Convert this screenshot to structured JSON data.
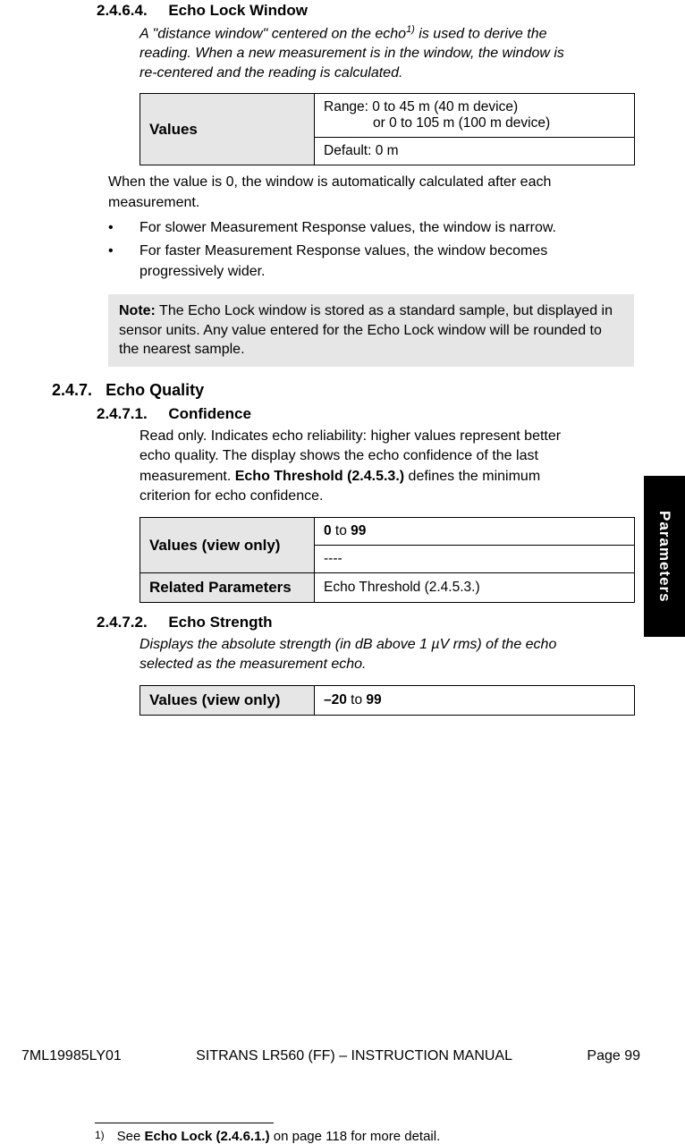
{
  "sideTab": "Parameters",
  "s2464": {
    "num": "2.4.6.4.",
    "title": "Echo Lock Window",
    "intro_a": "A \"distance window\" centered on the echo",
    "intro_sup": "1)",
    "intro_b": " is used to derive the reading. When a new measurement is in the window, the window is re-centered and the reading is calculated.",
    "valuesLabel": "Values",
    "range1": "Range: 0 to 45 m (40 m device)",
    "range2": "or 0 to 105 m (100 m device)",
    "default": "Default: 0 m",
    "belowTable": "When the value is 0, the window is automatically calculated after each measurement.",
    "bul1": "For slower Measurement Response values, the window is narrow.",
    "bul2": "For faster Measurement Response values, the window becomes progressively wider.",
    "noteLabel": "Note:",
    "noteBody": " The Echo Lock window is stored as a standard sample, but displayed in sensor units. Any value entered for the Echo Lock window will be rounded to the nearest sample."
  },
  "s247": {
    "num": "2.4.7.",
    "title": "Echo Quality"
  },
  "s2471": {
    "num": "2.4.7.1.",
    "title": "Confidence",
    "body_a": "Read only. Indicates echo reliability: higher values represent better echo quality. The display shows the echo confidence of the last measurement. ",
    "body_bold": "Echo Threshold (2.4.5.3.)",
    "body_b": " defines the minimum criterion for echo confidence.",
    "valuesLabel": "Values (view only)",
    "range_a": "0",
    "range_mid": " to ",
    "range_b": "99",
    "dashes": "----",
    "relatedLabel": "Related Parameters",
    "relatedVal": "Echo Threshold (2.4.5.3.)"
  },
  "s2472": {
    "num": "2.4.7.2.",
    "title": "Echo Strength",
    "body": "Displays the absolute strength (in dB above 1 µV rms) of the echo selected as the measurement echo.",
    "valuesLabel": "Values (view only)",
    "range_a": "–20",
    "range_mid": " to ",
    "range_b": "99"
  },
  "footnote": {
    "marker": "1)",
    "text_a": "See ",
    "text_bold": "Echo Lock (2.4.6.1.)",
    "text_b": " on page 118 for more detail."
  },
  "footer": {
    "left": "7ML19985LY01",
    "center": "SITRANS LR560 (FF) – INSTRUCTION MANUAL",
    "right": "Page 99"
  }
}
